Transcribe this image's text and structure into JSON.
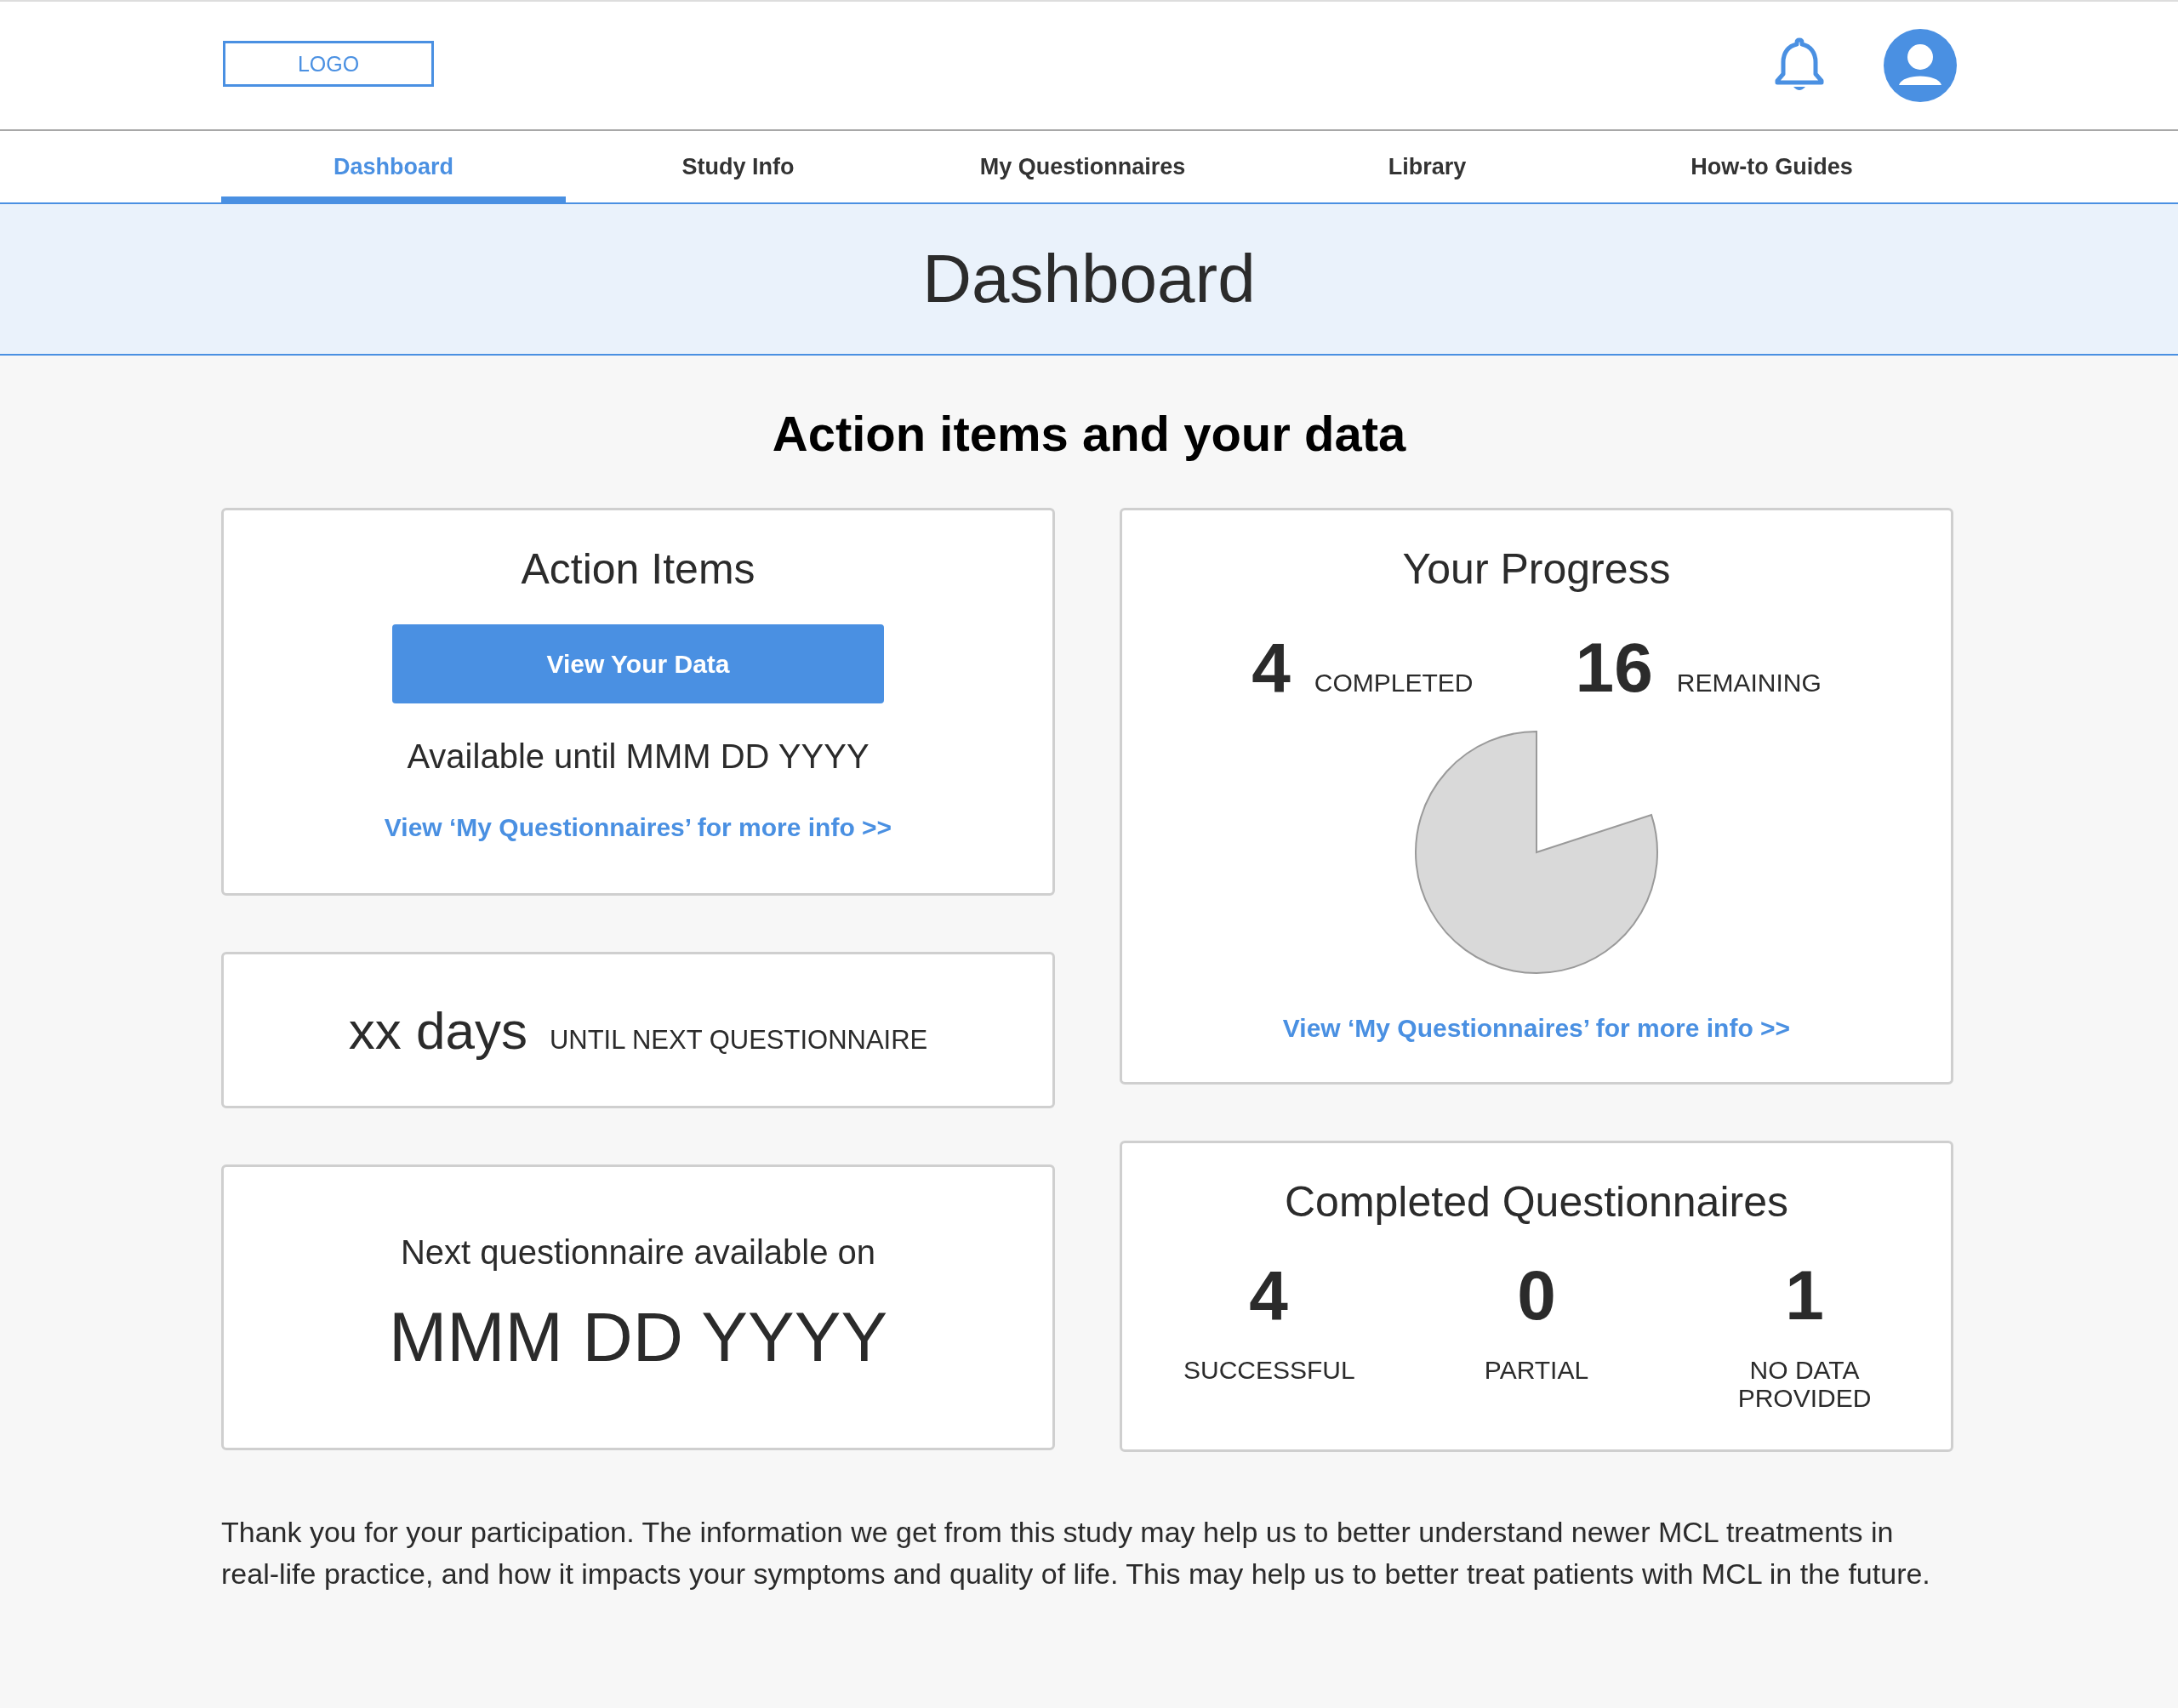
{
  "header": {
    "logo": "LOGO"
  },
  "nav": {
    "tabs": [
      {
        "label": "Dashboard",
        "selected": true
      },
      {
        "label": "Study Info",
        "selected": false
      },
      {
        "label": "My Questionnaires",
        "selected": false
      },
      {
        "label": "Library",
        "selected": false
      },
      {
        "label": "How-to Guides",
        "selected": false
      }
    ]
  },
  "page_title": "Dashboard",
  "section_heading": "Action items and your data",
  "action_items": {
    "title": "Action Items",
    "button": "View Your Data",
    "availability": "Available until MMM DD YYYY",
    "link": "View ‘My Questionnaires’ for more info >>"
  },
  "countdown": {
    "value": "xx days",
    "label": "UNTIL NEXT QUESTIONNAIRE"
  },
  "next_questionnaire": {
    "label": "Next questionnaire available on",
    "date": "MMM DD YYYY"
  },
  "progress": {
    "title": "Your Progress",
    "stats": [
      {
        "value": "4",
        "label": "COMPLETED"
      },
      {
        "value": "16",
        "label": "REMAINING"
      }
    ],
    "link": "View ‘My Questionnaires’ for more info >>"
  },
  "completed": {
    "title": "Completed Questionnaires",
    "stats": [
      {
        "value": "4",
        "label": "SUCCESSFUL"
      },
      {
        "value": "0",
        "label": "PARTIAL"
      },
      {
        "value": "1",
        "label": "NO DATA PROVIDED"
      }
    ]
  },
  "footer_text": "Thank you for your participation. The information we get from this study may help us to better understand newer MCL treatments in real-life practice, and how it impacts your symptoms and quality of life. This may help us to better treat patients with MCL in the future."
}
